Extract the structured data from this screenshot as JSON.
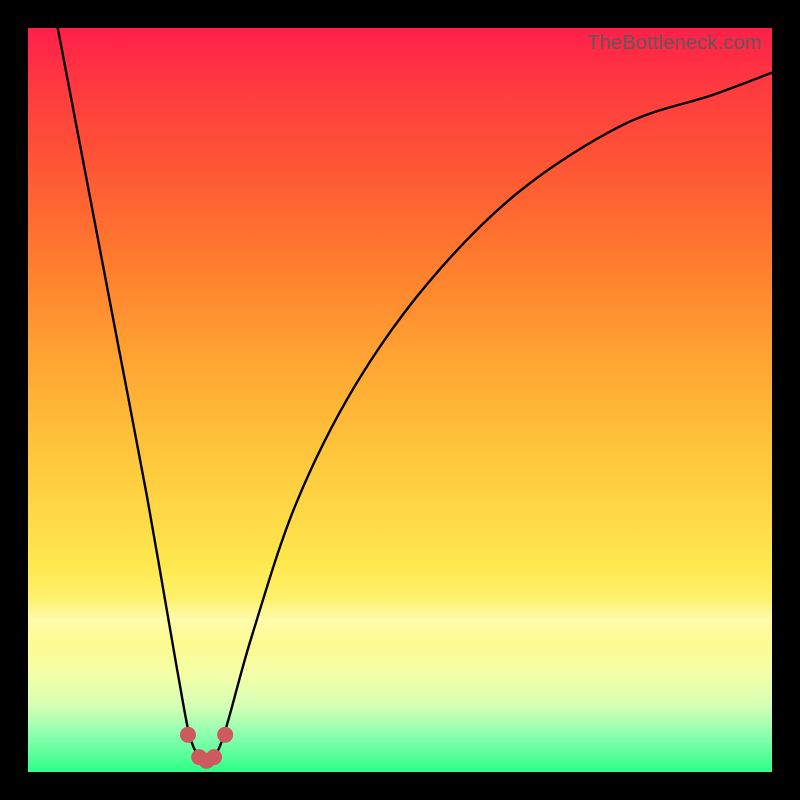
{
  "watermark": "TheBottleneck.com",
  "chart_data": {
    "type": "line",
    "title": "",
    "xlabel": "",
    "ylabel": "",
    "xlim": [
      0,
      100
    ],
    "ylim": [
      0,
      100
    ],
    "grid": false,
    "legend": false,
    "series": [
      {
        "name": "curve",
        "x": [
          4,
          8,
          12,
          16,
          20,
          22,
          24,
          26,
          30,
          36,
          44,
          54,
          66,
          80,
          92,
          100
        ],
        "values": [
          100,
          79,
          58,
          37,
          14,
          4,
          2,
          4,
          18,
          36,
          52,
          66,
          78,
          87,
          91,
          94
        ]
      }
    ],
    "markers": [
      {
        "x": 21.5,
        "y": 5
      },
      {
        "x": 23.0,
        "y": 2
      },
      {
        "x": 24.0,
        "y": 1.5
      },
      {
        "x": 25.0,
        "y": 2
      },
      {
        "x": 26.5,
        "y": 5
      }
    ]
  },
  "colors": {
    "curve": "#000000",
    "markers": "#cc5a5f"
  }
}
